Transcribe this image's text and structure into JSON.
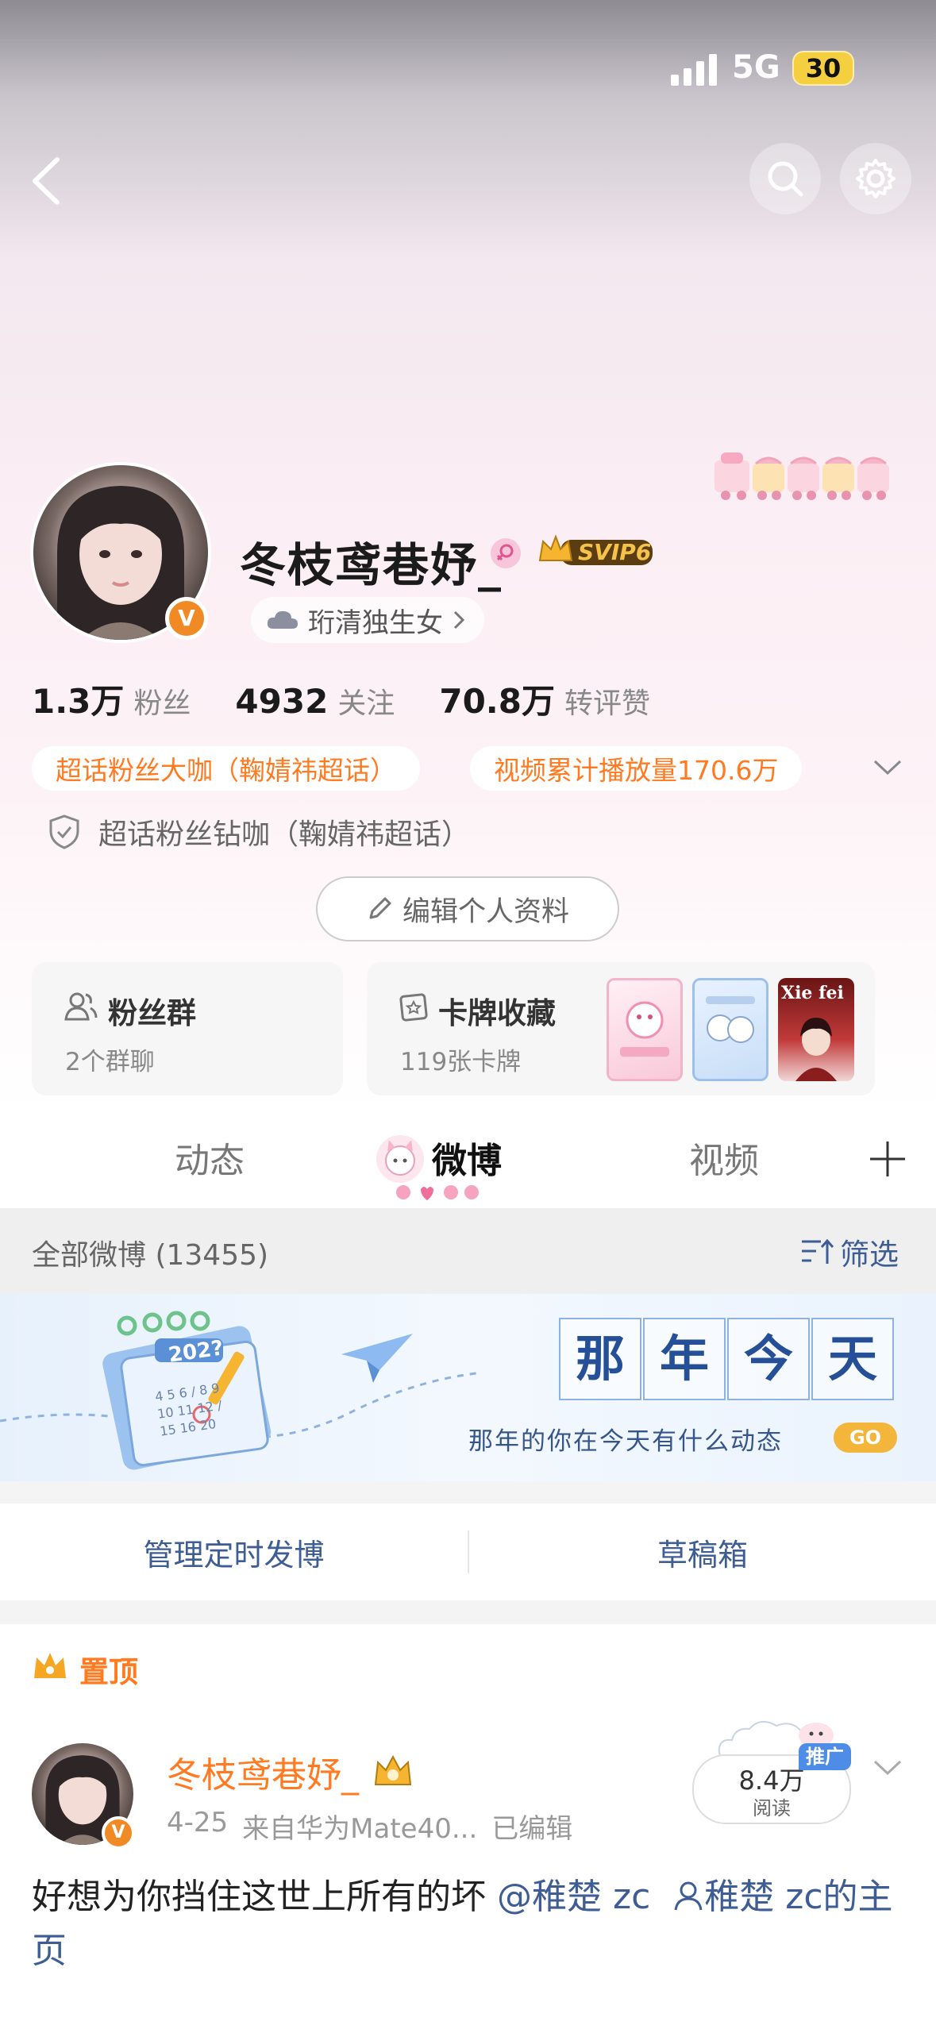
{
  "status_bar": {
    "network": "5G",
    "battery": "30"
  },
  "profile": {
    "name": "冬枝鸢巷妤_",
    "vip_badge": "SVIP6",
    "group_label": "珩清独生女",
    "stats": [
      {
        "value": "1.3万",
        "label": "粉丝"
      },
      {
        "value": "4932",
        "label": "关注"
      },
      {
        "value": "70.8万",
        "label": "转评赞"
      }
    ],
    "tags": [
      "超话粉丝大咖（鞠婧祎超话）",
      "视频累计播放量170.6万"
    ],
    "diamond_tag": "超话粉丝钻咖（鞠婧祎超话）",
    "edit_button": "编辑个人资料"
  },
  "cards": {
    "fan_group": {
      "title": "粉丝群",
      "subtitle": "2个群聊"
    },
    "card_collection": {
      "title": "卡牌收藏",
      "subtitle": "119张卡牌",
      "thumb3_text": "Xie fei"
    }
  },
  "tabs": [
    "动态",
    "微博",
    "视频"
  ],
  "filter": {
    "all_label": "全部微博 (13455)",
    "filter_label": "筛选"
  },
  "banner": {
    "year": "202?",
    "chars": [
      "那",
      "年",
      "今",
      "天"
    ],
    "subtitle": "那年的你在今天有什么动态",
    "go": "GO",
    "calendar_nums": "4 5 6 / 8 9 10 11 12 / 15 16 20"
  },
  "actions": {
    "scheduled": "管理定时发博",
    "drafts": "草稿箱"
  },
  "pinned": {
    "label": "置顶",
    "author": "冬枝鸢巷妤_",
    "date": "4-25",
    "source": "来自华为Mate40...",
    "edited": "已编辑",
    "promo_badge": "推广",
    "views": "8.4万",
    "views_label": "阅读",
    "text": "好想为你挡住这世上所有的坏 ",
    "mention": "@稚楚 zc",
    "link": "稚楚 zc的主页"
  },
  "colors": {
    "accent_orange": "#ff7a20",
    "link_blue": "#3d5d94"
  }
}
